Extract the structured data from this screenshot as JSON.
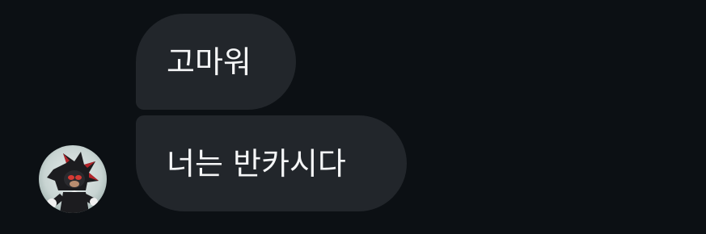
{
  "messages": [
    {
      "text": "고마워"
    },
    {
      "text": "너는 반카시다"
    }
  ],
  "sender": {
    "avatar_icon": "shadow-hedgehog-avatar-icon"
  },
  "colors": {
    "background": "#0c1014",
    "bubble": "#22262b",
    "text": "#f5f6f7"
  }
}
